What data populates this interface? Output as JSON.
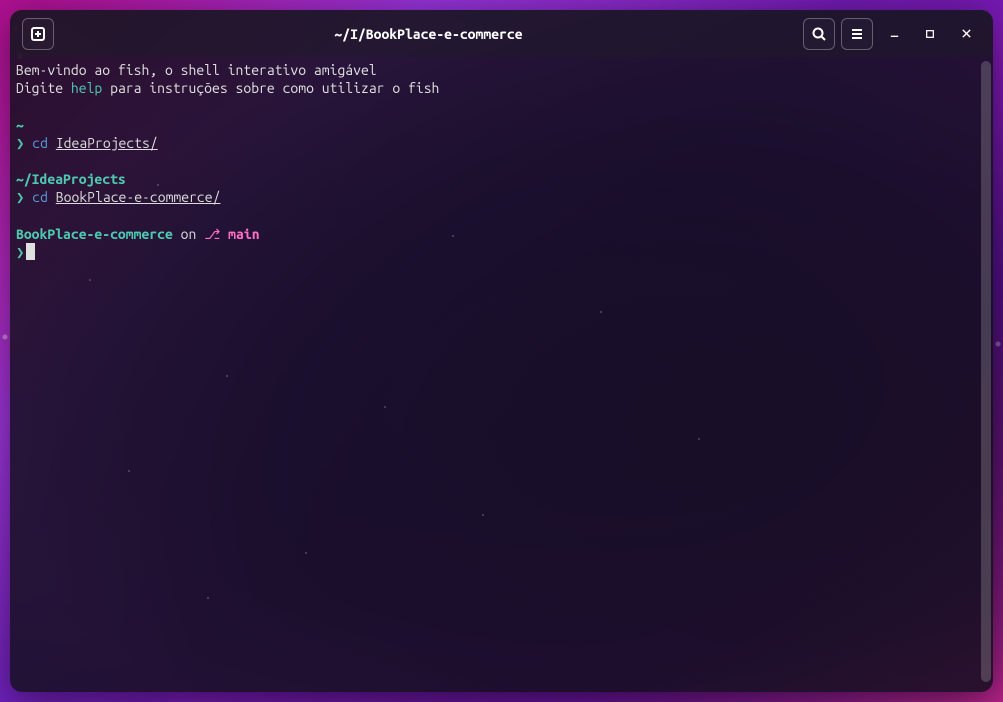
{
  "titlebar": {
    "title": "~/I/BookPlace-e-commerce"
  },
  "terminal": {
    "welcome_line1": "Bem-vindo ao fish, o shell interativo amigável",
    "welcome_line2_pre": "Digite ",
    "welcome_line2_help": "help",
    "welcome_line2_post": " para instruções sobre como utilizar o fish",
    "block1": {
      "path": "~",
      "prompt": "❯",
      "cmd": "cd",
      "arg": "IdeaProjects/"
    },
    "block2": {
      "path": "~/IdeaProjects",
      "prompt": "❯",
      "cmd": "cd",
      "arg": "BookPlace-e-commerce/"
    },
    "block3": {
      "project": "BookPlace-e-commerce",
      "on": " on ",
      "branch_glyph": "⎇",
      "branch": " main",
      "prompt": "❯"
    }
  }
}
